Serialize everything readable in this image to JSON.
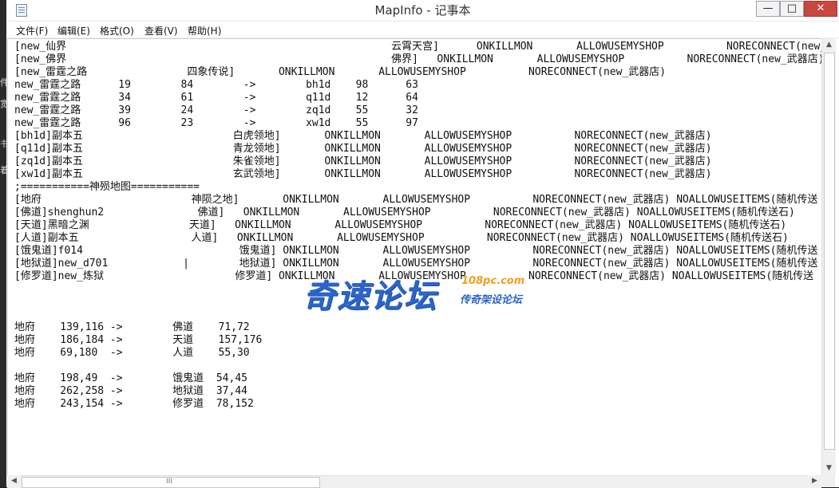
{
  "window": {
    "title": "MapInfo - 记事本",
    "controls": {
      "minimize": "—",
      "maximize": "□",
      "close": "✕"
    }
  },
  "menubar": {
    "items": [
      "文件(F)",
      "编辑(E)",
      "格式(O)",
      "查看(V)",
      "帮助(H)"
    ]
  },
  "desktop_glyphs": [
    "件",
    "宽",
    "书",
    "着"
  ],
  "editor": {
    "lines": [
      "[new_仙界                                                    云霄天宫]      ONKILLMON       ALLOWUSEMYSHOP          NORECONNECT(new_武器店",
      "[new_佛界                                                    佛界]   ONKILLMON       ALLOWUSEMYSHOP          NORECONNECT(new_武器店)",
      "[new_雷霆之路                四象传说]       ONKILLMON       ALLOWUSEMYSHOP          NORECONNECT(new_武器店)",
      "new_雷霆之路      19        84        ->        bh1d    98      63",
      "new_雷霆之路      34        61        ->        q11d    12      64",
      "new_雷霆之路      39        24        ->        zq1d    55      32",
      "new_雷霆之路      96        23        ->        xw1d    55      97",
      "[bh1d]副本五                        白虎领地]       ONKILLMON       ALLOWUSEMYSHOP          NORECONNECT(new_武器店)",
      "[q11d]副本五                        青龙领地]       ONKILLMON       ALLOWUSEMYSHOP          NORECONNECT(new_武器店)",
      "[zq1d]副本五                        朱雀领地]       ONKILLMON       ALLOWUSEMYSHOP          NORECONNECT(new_武器店)",
      "[xw1d]副本五                        玄武领地]       ONKILLMON       ALLOWUSEMYSHOP          NORECONNECT(new_武器店)",
      ";===========神殒地图===========",
      "[地府                        神陨之地]       ONKILLMON       ALLOWUSEMYSHOP          NORECONNECT(new_武器店) NOALLOWUSEITEMS(随机传送",
      "[佛道]shenghun2               佛道]   ONKILLMON       ALLOWUSEMYSHOP          NORECONNECT(new_武器店) NOALLOWUSEITEMS(随机传送石)",
      "[天道]黑暗之渊                天道]   ONKILLMON       ALLOWUSEMYSHOP          NORECONNECT(new_武器店) NOALLOWUSEITEMS(随机传送石)",
      "[人道]副本五                  人道]   ONKILLMON       ALLOWUSEMYSHOP          NORECONNECT(new_武器店) NOALLOWUSEITEMS(随机传送石)",
      "[饿鬼道]f014                         饿鬼道] ONKILLMON       ALLOWUSEMYSHOP          NORECONNECT(new_武器店) NOALLOWUSEITEMS(随机传送",
      "[地狱道]new_d701            |        地狱道] ONKILLMON       ALLOWUSEMYSHOP          NORECONNECT(new_武器店) NOALLOWUSEITEMS(随机传送",
      "[修罗道]new_炼狱                     修罗道] ONKILLMON       ALLOWUSEMYSHOP          NORECONNECT(new_武器店) NOALLOWUSEITEMS(随机传送",
      "",
      "",
      "",
      "地府    139,116 ->        佛道    71,72",
      "地府    186,184 ->        天道    157,176",
      "地府    69,180  ->        人道    55,30",
      "",
      "地府    198,49  ->        饿鬼道  54,45",
      "地府    262,258 ->        地狱道  37,44",
      "地府    243,154 ->        修罗道  78,152"
    ]
  },
  "watermark": {
    "main": "奇速论坛",
    "url": "108pc.com",
    "sub": "传奇架设论坛"
  },
  "scrollbars": {
    "up": "▲",
    "down": "▼",
    "left": "◀",
    "right": "▶",
    "grip": "III"
  }
}
